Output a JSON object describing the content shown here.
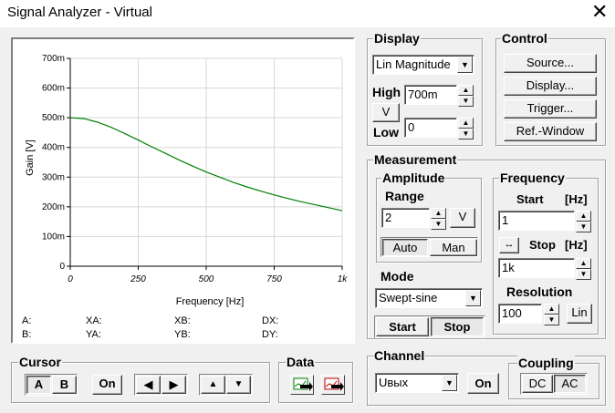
{
  "window": {
    "title": "Signal Analyzer - Virtual",
    "close_glyph": "✕"
  },
  "plot": {
    "y_axis_label": "Gain [V]",
    "x_axis_label": "Frequency [Hz]",
    "y_ticks": [
      "700m",
      "600m",
      "500m",
      "400m",
      "300m",
      "200m",
      "100m",
      "0"
    ],
    "x_ticks": [
      "0",
      "250",
      "500",
      "750",
      "1k"
    ],
    "trace_color": "#008000",
    "readouts": {
      "a": "A:",
      "b": "B:",
      "xa": "XA:",
      "ya": "YA:",
      "xb": "XB:",
      "yb": "YB:",
      "dx": "DX:",
      "dy": "DY:"
    }
  },
  "chart_data": {
    "type": "line",
    "xlabel": "Frequency [Hz]",
    "ylabel": "Gain [V]",
    "xlim": [
      0,
      1000
    ],
    "ylim": [
      0,
      0.7
    ],
    "grid": true,
    "series": [
      {
        "x": [
          0,
          50,
          100,
          150,
          200,
          250,
          300,
          350,
          400,
          450,
          500,
          550,
          600,
          650,
          700,
          750,
          800,
          850,
          900,
          950,
          1000
        ],
        "values": [
          0.5,
          0.497,
          0.485,
          0.468,
          0.447,
          0.425,
          0.402,
          0.38,
          0.358,
          0.337,
          0.317,
          0.3,
          0.282,
          0.267,
          0.253,
          0.24,
          0.228,
          0.217,
          0.207,
          0.197,
          0.187
        ]
      }
    ]
  },
  "display": {
    "group": "Display",
    "mode_value": "Lin Magnitude",
    "high_label": "High",
    "high_value": "700m",
    "unit_button": "V",
    "low_label": "Low",
    "low_value": "0"
  },
  "control": {
    "group": "Control",
    "source": "Source...",
    "display": "Display...",
    "trigger": "Trigger...",
    "ref_window": "Ref.-Window"
  },
  "measurement": {
    "group": "Measurement",
    "amplitude": {
      "group": "Amplitude",
      "range_label": "Range",
      "range_value": "2",
      "unit_button": "V",
      "auto": "Auto",
      "man": "Man"
    },
    "frequency": {
      "group": "Frequency",
      "start_label": "Start",
      "unit_label": "[Hz]",
      "start_value": "1",
      "stop_label": "Stop",
      "stop_unit_label": "[Hz]",
      "stop_value": "1k",
      "resolution_label": "Resolution",
      "resolution_value": "100",
      "lin_button": "Lin"
    },
    "mode": {
      "label": "Mode",
      "value": "Swept-sine",
      "start": "Start",
      "stop": "Stop"
    }
  },
  "cursor": {
    "group": "Cursor",
    "a": "A",
    "b": "B",
    "on": "On"
  },
  "data_group": {
    "group": "Data"
  },
  "channel": {
    "group": "Channel",
    "value": "Uвых",
    "on": "On"
  },
  "coupling": {
    "group": "Coupling",
    "dc": "DC",
    "ac": "AC"
  }
}
